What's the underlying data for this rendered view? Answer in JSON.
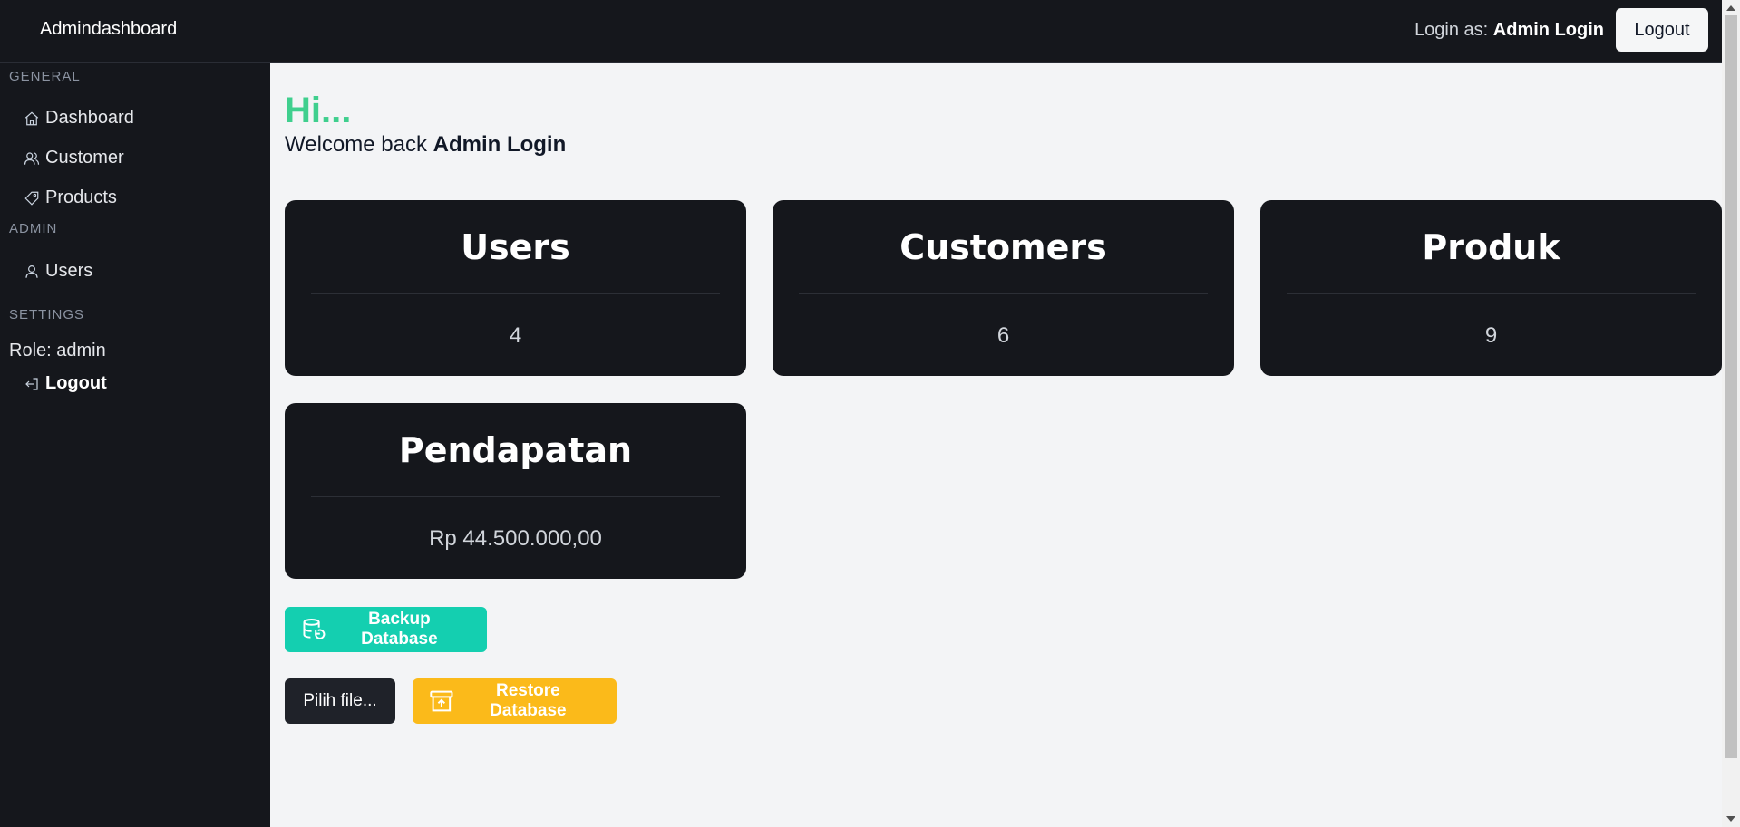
{
  "navbar": {
    "brand": "Admindashboard",
    "login_prefix": "Login as:",
    "login_user": "Admin Login",
    "logout_label": "Logout"
  },
  "sidebar": {
    "sections": {
      "general": "GENERAL",
      "admin": "ADMIN",
      "settings": "SETTINGS"
    },
    "items": [
      {
        "label": "Dashboard",
        "icon": "home-icon"
      },
      {
        "label": "Customer",
        "icon": "users-icon"
      },
      {
        "label": "Products",
        "icon": "tag-icon"
      },
      {
        "label": "Users",
        "icon": "user-icon"
      }
    ],
    "role_text": "Role: admin",
    "logout_label": "Logout"
  },
  "main": {
    "greeting": "Hi...",
    "welcome_prefix": "Welcome back",
    "welcome_user": "Admin Login",
    "cards": [
      {
        "title": "Users",
        "value": "4"
      },
      {
        "title": "Customers",
        "value": "6"
      },
      {
        "title": "Produk",
        "value": "9"
      },
      {
        "title": "Pendapatan",
        "value": "Rp 44.500.000,00"
      }
    ],
    "backup_label": "Backup Database",
    "file_label": "Pilih file...",
    "restore_label": "Restore Database"
  },
  "colors": {
    "greeting": "#3fcf8e",
    "backup_button": "#14cfb0",
    "restore_button": "#fbba1a",
    "dark_panel": "#15171c"
  }
}
